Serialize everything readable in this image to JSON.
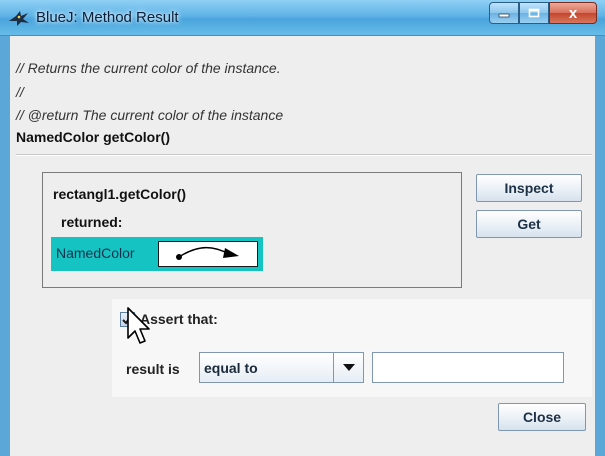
{
  "window": {
    "title": "BlueJ:  Method Result",
    "controls": {
      "minimize_icon": "minimize-icon",
      "maximize_icon": "maximize-icon",
      "close_label": "x"
    }
  },
  "method": {
    "comment_lines": [
      "// Returns the current color of the instance.",
      "//",
      "// @return The current color of the instance"
    ],
    "signature": "NamedColor getColor()"
  },
  "result": {
    "call": "rectangl1.getColor()",
    "returned_label": "returned:",
    "object_type": "NamedColor",
    "object_ref_icon": "object-reference-arrow-icon"
  },
  "buttons": {
    "inspect": "Inspect",
    "get": "Get",
    "close": "Close"
  },
  "assertion": {
    "checked": true,
    "label": "Assert that:",
    "result_is_label": "result is",
    "comparator": "equal to",
    "value": ""
  },
  "colors": {
    "titlebar": "#5fb3e6",
    "object_box": "#16c3c3",
    "close_button": "#c4452d"
  }
}
